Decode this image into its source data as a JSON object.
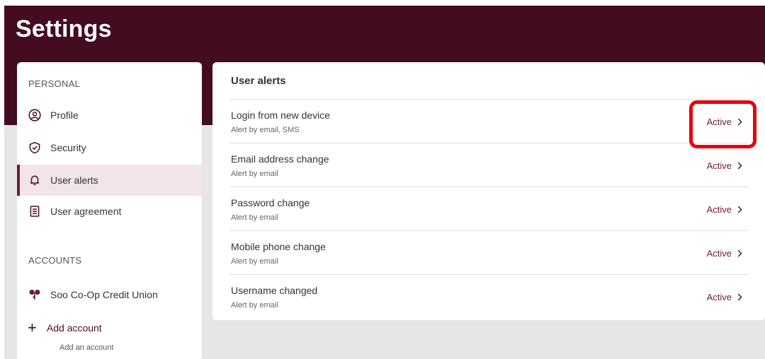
{
  "header": {
    "title": "Settings"
  },
  "sidebar": {
    "personal_heading": "PERSONAL",
    "personal_items": [
      {
        "label": "Profile",
        "icon": "profile-icon"
      },
      {
        "label": "Security",
        "icon": "shield-icon"
      },
      {
        "label": "User alerts",
        "icon": "bell-icon",
        "active": true
      },
      {
        "label": "User agreement",
        "icon": "document-icon"
      }
    ],
    "accounts_heading": "ACCOUNTS",
    "account": {
      "label": "Soo Co-Op Credit Union",
      "icon": "credit-union-logo-icon"
    },
    "add_account": {
      "label": "Add account",
      "sublabel": "Add an account",
      "icon": "plus-icon"
    }
  },
  "panel": {
    "title": "User alerts",
    "alerts": [
      {
        "name": "Login from new device",
        "description": "Alert by email, SMS",
        "status": "Active"
      },
      {
        "name": "Email address change",
        "description": "Alert by email",
        "status": "Active"
      },
      {
        "name": "Password change",
        "description": "Alert by email",
        "status": "Active"
      },
      {
        "name": "Mobile phone change",
        "description": "Alert by email",
        "status": "Active"
      },
      {
        "name": "Username changed",
        "description": "Alert by email",
        "status": "Active"
      }
    ]
  },
  "colors": {
    "brand": "#440c20",
    "accent": "#6e1a3a",
    "active_bg": "#f1e4ea",
    "highlight": "#e8000c"
  }
}
